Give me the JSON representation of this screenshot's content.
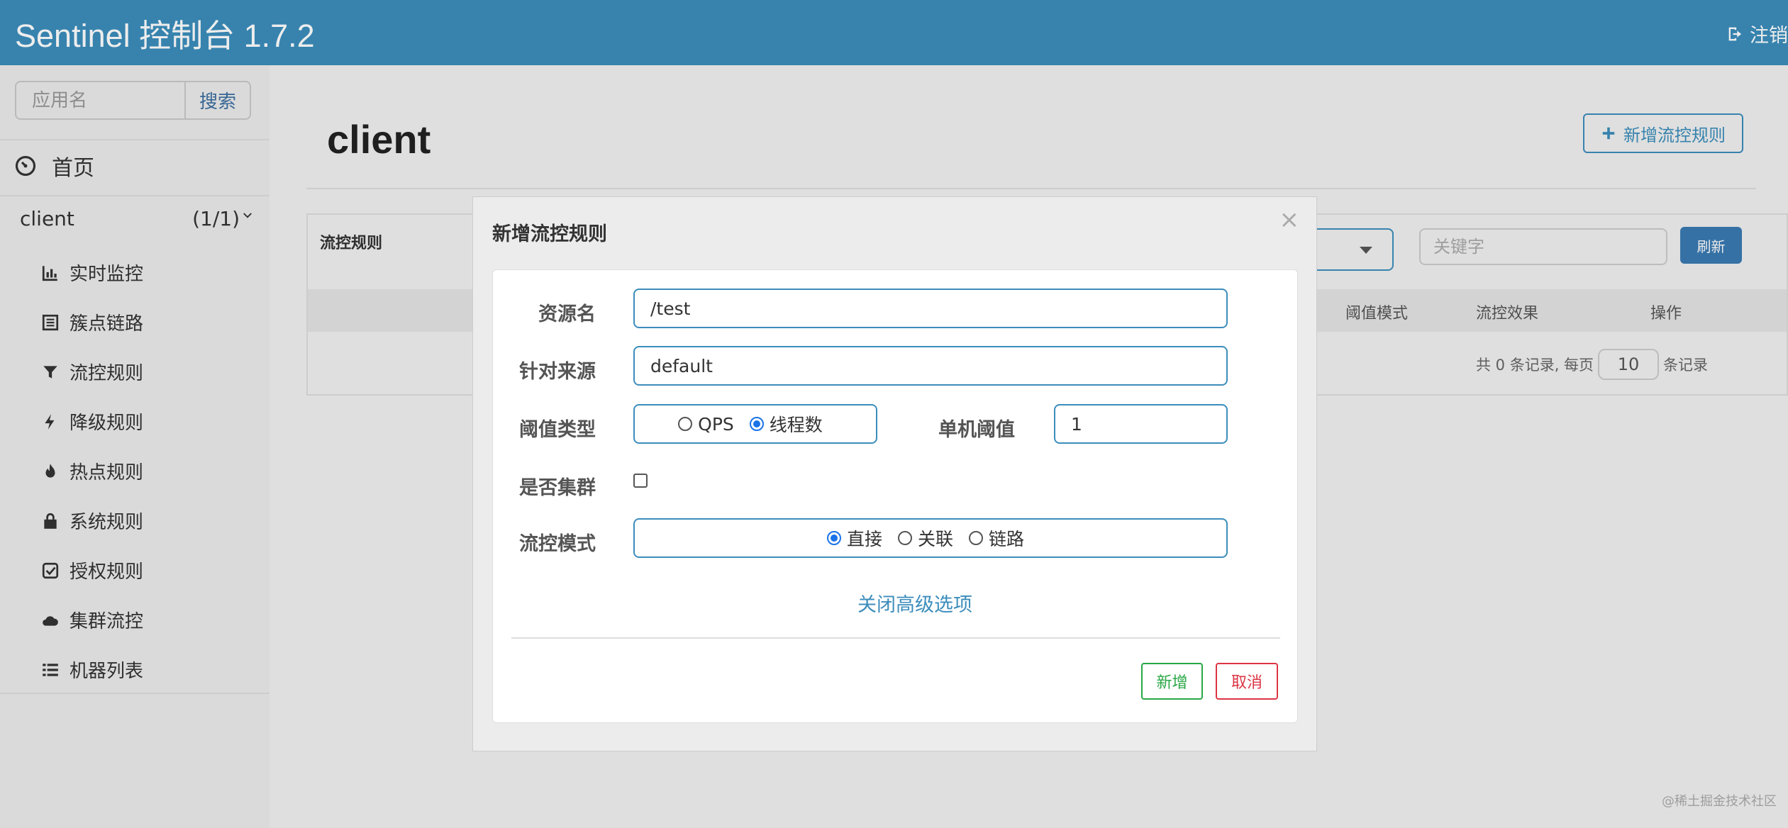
{
  "header": {
    "brand": "Sentinel 控制台 1.7.2",
    "logout_label": "注销"
  },
  "sidebar": {
    "search_placeholder": "应用名",
    "search_button": "搜索",
    "home_label": "首页",
    "app": {
      "name": "client",
      "count": "(1/1)"
    },
    "items": [
      {
        "label": "实时监控",
        "icon": "bar-chart-icon"
      },
      {
        "label": "簇点链路",
        "icon": "list-alt-icon"
      },
      {
        "label": "流控规则",
        "icon": "filter-icon"
      },
      {
        "label": "降级规则",
        "icon": "flash-icon"
      },
      {
        "label": "热点规则",
        "icon": "fire-icon"
      },
      {
        "label": "系统规则",
        "icon": "lock-icon"
      },
      {
        "label": "授权规则",
        "icon": "check-icon"
      },
      {
        "label": "集群流控",
        "icon": "cloud-icon"
      },
      {
        "label": "机器列表",
        "icon": "list-icon"
      }
    ]
  },
  "main": {
    "title": "client",
    "add_rule_button": "新增流控规则",
    "panel_title": "流控规则",
    "keyword_placeholder": "关键字",
    "refresh_button": "刷新",
    "columns": [
      "阈值模式",
      "流控效果",
      "操作"
    ],
    "pager": {
      "prefix": "共 0 条记录, 每页",
      "page_size": "10",
      "suffix": "条记录"
    }
  },
  "modal": {
    "title": "新增流控规则",
    "close_symbol": "×",
    "fields": {
      "resource_label": "资源名",
      "resource_value": "/test",
      "origin_label": "针对来源",
      "origin_value": "default",
      "threshold_type_label": "阈值类型",
      "threshold_type_options": [
        "QPS",
        "线程数"
      ],
      "threshold_type_selected": "线程数",
      "single_threshold_label": "单机阈值",
      "single_threshold_value": "1",
      "cluster_label": "是否集群",
      "cluster_checked": false,
      "mode_label": "流控模式",
      "mode_options": [
        "直接",
        "关联",
        "链路"
      ],
      "mode_selected": "直接"
    },
    "advanced_link": "关闭高级选项",
    "ok_button": "新增",
    "cancel_button": "取消"
  },
  "watermark": "@稀土掘金技术社区",
  "colors": {
    "navbar": "#3c8dbc",
    "primary": "#3c8dbc",
    "success": "#28a745",
    "danger": "#dc3545"
  }
}
